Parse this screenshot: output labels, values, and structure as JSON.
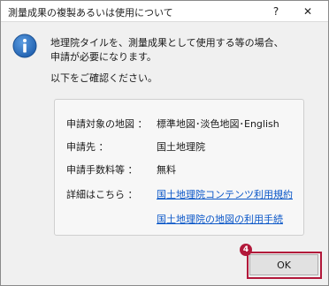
{
  "window": {
    "title": "測量成果の複製あるいは使用について",
    "help_label": "?",
    "close_label": "✕"
  },
  "icons": {
    "info": "info-icon",
    "accent": "#2a6ebd"
  },
  "message": {
    "line1": "地理院タイルを、測量成果として使用する等の場合、",
    "line2": "申請が必要になります。",
    "line3": "以下をご確認ください。"
  },
  "details": {
    "target_label": "申請対象の地図 ：",
    "target_value": "標準地図･淡色地図･English",
    "applicant_label": "申請先 ：",
    "applicant_value": "国土地理院",
    "fee_label": "申請手数料等 ：",
    "fee_value": "無料",
    "more_label": "詳細はこちら ：",
    "link1": "国土地理院コンテンツ利用規約",
    "link2": "国土地理院の地図の利用手続"
  },
  "buttons": {
    "ok": "OK"
  },
  "annotation": {
    "step": "4",
    "color": "#b2183a"
  }
}
